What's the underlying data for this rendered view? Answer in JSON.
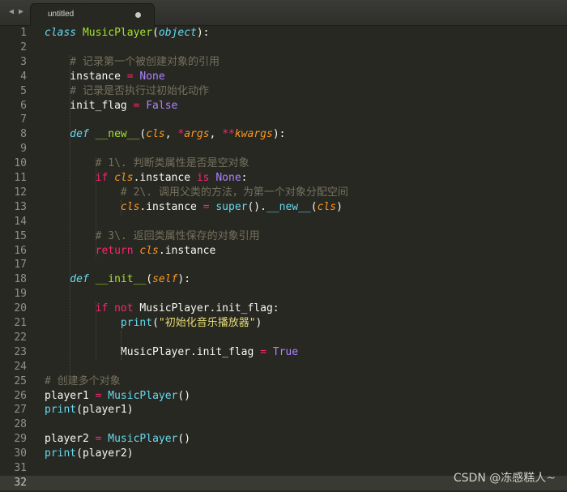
{
  "tab": {
    "title": "untitled",
    "dirty_indicator": "●"
  },
  "nav": {
    "back": "◀",
    "forward": "▶"
  },
  "watermark": "CSDN @冻感糕人~",
  "lines": [
    {
      "n": "1",
      "t": [
        [
          "kwi",
          "class "
        ],
        [
          "cls",
          "MusicPlayer"
        ],
        [
          "",
          "("
        ],
        [
          "kwi",
          "object"
        ],
        [
          "",
          "):"
        ]
      ]
    },
    {
      "n": "2",
      "t": []
    },
    {
      "n": "3",
      "t": [
        [
          "cm",
          "    # 记录第一个被创建对象的引用"
        ]
      ]
    },
    {
      "n": "4",
      "t": [
        [
          "",
          "    instance "
        ],
        [
          "op",
          "="
        ],
        [
          "const",
          " None"
        ]
      ]
    },
    {
      "n": "5",
      "t": [
        [
          "cm",
          "    # 记录是否执行过初始化动作"
        ]
      ]
    },
    {
      "n": "6",
      "t": [
        [
          "",
          "    init_flag "
        ],
        [
          "op",
          "="
        ],
        [
          "const",
          " False"
        ]
      ]
    },
    {
      "n": "7",
      "t": []
    },
    {
      "n": "8",
      "t": [
        [
          "kwi",
          "    def "
        ],
        [
          "cls",
          "__new__"
        ],
        [
          "",
          "("
        ],
        [
          "it",
          "cls"
        ],
        [
          "",
          ", "
        ],
        [
          "op",
          "*"
        ],
        [
          "it",
          "args"
        ],
        [
          "",
          ", "
        ],
        [
          "op",
          "**"
        ],
        [
          "it",
          "kwargs"
        ],
        [
          "",
          "):"
        ]
      ]
    },
    {
      "n": "9",
      "t": []
    },
    {
      "n": "10",
      "t": [
        [
          "cm",
          "        # 1\\. 判断类属性是否是空对象"
        ]
      ]
    },
    {
      "n": "11",
      "t": [
        [
          "kw",
          "        if "
        ],
        [
          "it",
          "cls"
        ],
        [
          "",
          ".instance "
        ],
        [
          "kw",
          "is"
        ],
        [
          "const",
          " None"
        ],
        [
          "",
          ":"
        ]
      ]
    },
    {
      "n": "12",
      "t": [
        [
          "cm",
          "            # 2\\. 调用父类的方法，为第一个对象分配空间"
        ]
      ]
    },
    {
      "n": "13",
      "t": [
        [
          "it",
          "            cls"
        ],
        [
          "",
          ".instance "
        ],
        [
          "op",
          "="
        ],
        [
          "bi",
          " super"
        ],
        [
          "",
          "()."
        ],
        [
          "bi",
          "__new__"
        ],
        [
          "",
          "("
        ],
        [
          "it",
          "cls"
        ],
        [
          "",
          ")"
        ]
      ]
    },
    {
      "n": "14",
      "t": []
    },
    {
      "n": "15",
      "t": [
        [
          "cm",
          "        # 3\\. 返回类属性保存的对象引用"
        ]
      ]
    },
    {
      "n": "16",
      "t": [
        [
          "kw",
          "        return "
        ],
        [
          "it",
          "cls"
        ],
        [
          "",
          ".instance"
        ]
      ]
    },
    {
      "n": "17",
      "t": []
    },
    {
      "n": "18",
      "t": [
        [
          "kwi",
          "    def "
        ],
        [
          "cls",
          "__init__"
        ],
        [
          "",
          "("
        ],
        [
          "it",
          "self"
        ],
        [
          "",
          "):"
        ]
      ]
    },
    {
      "n": "19",
      "t": []
    },
    {
      "n": "20",
      "t": [
        [
          "kw",
          "        if not "
        ],
        [
          "",
          "MusicPlayer.init_flag:"
        ]
      ]
    },
    {
      "n": "21",
      "t": [
        [
          "bi",
          "            print"
        ],
        [
          "",
          "("
        ],
        [
          "str",
          "\"初始化音乐播放器\""
        ],
        [
          "",
          ")"
        ]
      ]
    },
    {
      "n": "22",
      "t": []
    },
    {
      "n": "23",
      "t": [
        [
          "",
          "            MusicPlayer.init_flag "
        ],
        [
          "op",
          "="
        ],
        [
          "const",
          " True"
        ]
      ]
    },
    {
      "n": "24",
      "t": []
    },
    {
      "n": "25",
      "t": [
        [
          "cm",
          "# 创建多个对象"
        ]
      ]
    },
    {
      "n": "26",
      "t": [
        [
          "",
          "player1 "
        ],
        [
          "op",
          "="
        ],
        [
          "bi",
          " MusicPlayer"
        ],
        [
          "",
          "()"
        ]
      ]
    },
    {
      "n": "27",
      "t": [
        [
          "bi",
          "print"
        ],
        [
          "",
          "(player1)"
        ]
      ]
    },
    {
      "n": "28",
      "t": []
    },
    {
      "n": "29",
      "t": [
        [
          "",
          "player2 "
        ],
        [
          "op",
          "="
        ],
        [
          "bi",
          " MusicPlayer"
        ],
        [
          "",
          "()"
        ]
      ]
    },
    {
      "n": "30",
      "t": [
        [
          "bi",
          "print"
        ],
        [
          "",
          "(player2)"
        ]
      ]
    },
    {
      "n": "31",
      "t": []
    },
    {
      "n": "32",
      "t": []
    }
  ],
  "active_line": "32"
}
